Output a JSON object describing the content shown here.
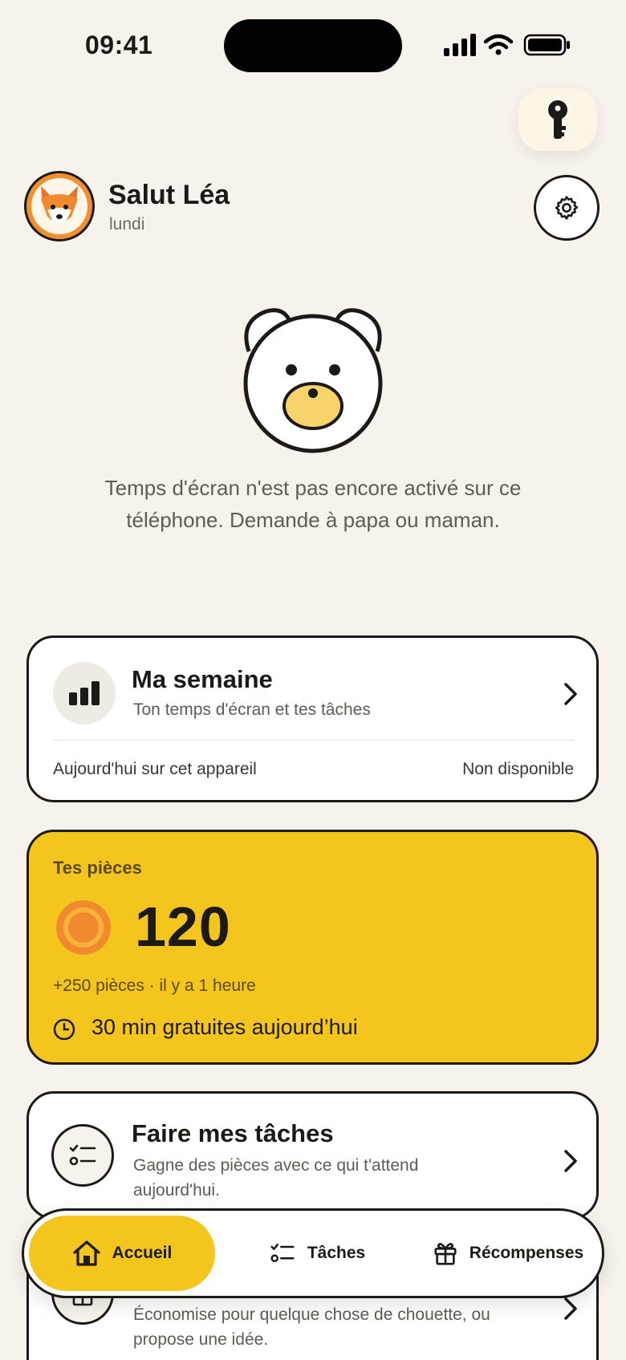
{
  "status_bar": {
    "time": "09:41"
  },
  "header": {
    "greeting": "Salut Léa",
    "day": "lundi"
  },
  "message": "Temps d'écran n'est pas encore activé sur ce téléphone. Demande à papa ou maman.",
  "week_card": {
    "title": "Ma semaine",
    "subtitle": "Ton temps d'écran et tes tâches",
    "left_label": "Aujourd'hui sur cet appareil",
    "right_value": "Non disponible"
  },
  "coins_card": {
    "label": "Tes pièces",
    "value": "120",
    "recent": "+250 pièces · il y a 1 heure",
    "free_time": "30 min gratuites aujourd’hui"
  },
  "tasks_card": {
    "title": "Faire mes tâches",
    "subtitle": "Gagne des pièces avec ce qui t'attend aujourd'hui."
  },
  "rewards_card": {
    "subtitle": "Économise pour quelque chose de chouette, ou propose une idée."
  },
  "tabbar": {
    "home": "Accueil",
    "tasks": "Tâches",
    "rewards": "Récompenses"
  },
  "colors": {
    "background": "#F7F3EC",
    "accent_yellow": "#F3C51D",
    "coin_orange": "#F0902E",
    "ink": "#1C1A17"
  }
}
